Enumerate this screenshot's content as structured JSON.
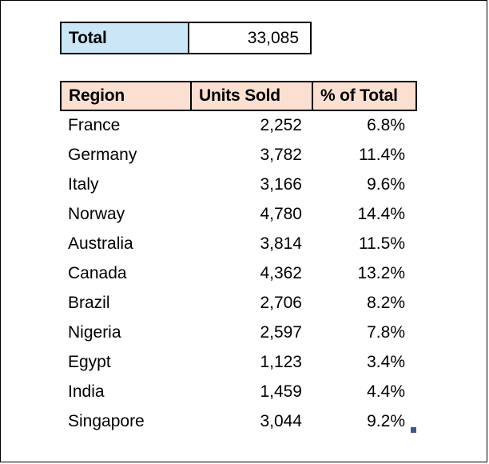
{
  "summary": {
    "label": "Total",
    "value": "33,085",
    "label_bg": "#cbe7f7",
    "value_bg": "#ffffff"
  },
  "table": {
    "header_bg": "#fbe0d2",
    "columns": [
      "Region",
      "Units Sold",
      "% of Total"
    ],
    "rows": [
      {
        "region": "France",
        "units": "2,252",
        "pct": "6.8%"
      },
      {
        "region": "Germany",
        "units": "3,782",
        "pct": "11.4%"
      },
      {
        "region": "Italy",
        "units": "3,166",
        "pct": "9.6%"
      },
      {
        "region": "Norway",
        "units": "4,780",
        "pct": "14.4%"
      },
      {
        "region": "Australia",
        "units": "3,814",
        "pct": "11.5%"
      },
      {
        "region": "Canada",
        "units": "4,362",
        "pct": "13.2%"
      },
      {
        "region": "Brazil",
        "units": "2,706",
        "pct": "8.2%"
      },
      {
        "region": "Nigeria",
        "units": "2,597",
        "pct": "7.8%"
      },
      {
        "region": "Egypt",
        "units": "1,123",
        "pct": "3.4%"
      },
      {
        "region": "India",
        "units": "1,459",
        "pct": "4.4%"
      },
      {
        "region": "Singapore",
        "units": "3,044",
        "pct": "9.2%"
      }
    ]
  },
  "selection": {
    "handle_color": "#41558f"
  }
}
